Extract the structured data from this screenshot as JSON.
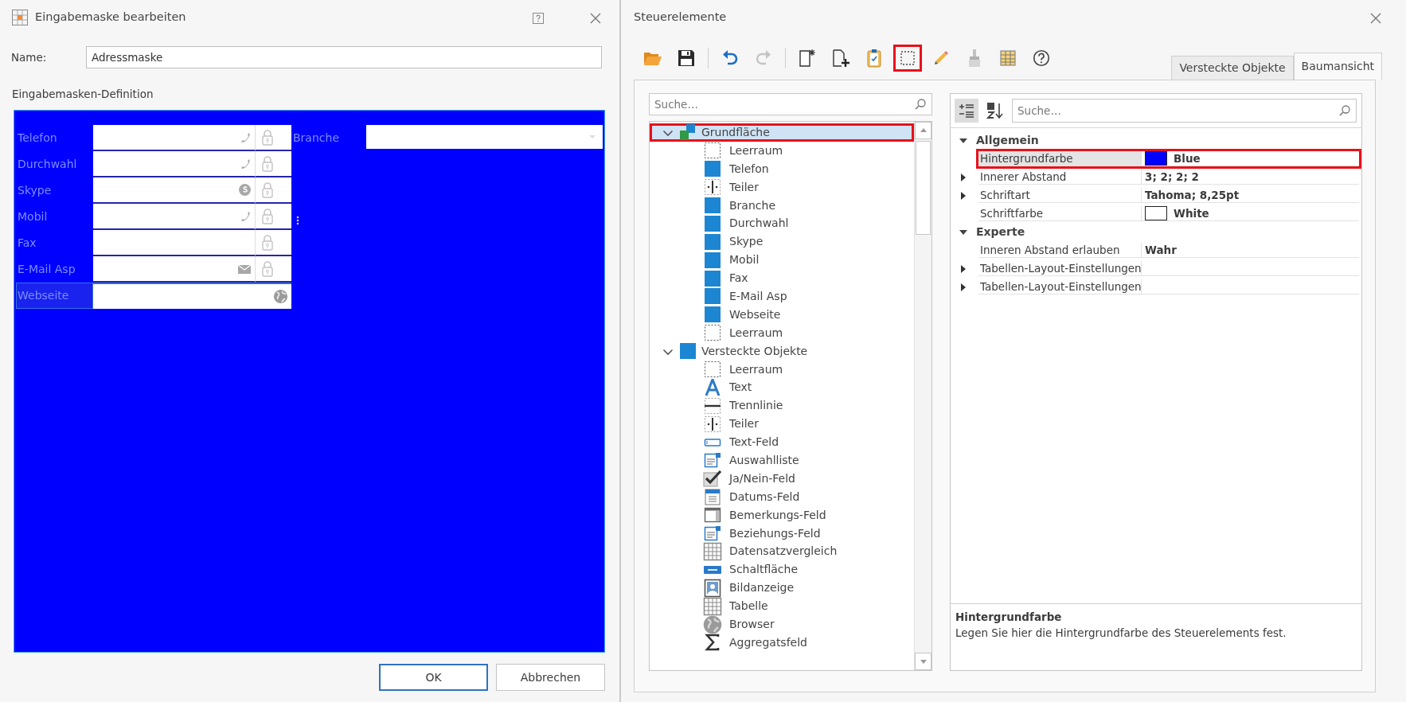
{
  "left_window": {
    "title": "Eingabemaske bearbeiten",
    "name_label": "Name:",
    "name_value": "Adressmaske",
    "section_label": "Eingabemasken-Definition",
    "canvas": {
      "color": "#0000ff",
      "fields": [
        {
          "label": "Telefon",
          "kind": "phone",
          "locked": true,
          "selected": false,
          "resize_handle": false
        },
        {
          "label": "Durchwahl",
          "kind": "phone",
          "locked": true,
          "selected": false,
          "resize_handle": false
        },
        {
          "label": "Skype",
          "kind": "skype",
          "locked": true,
          "selected": false,
          "resize_handle": false
        },
        {
          "label": "Mobil",
          "kind": "phone",
          "locked": true,
          "selected": false,
          "resize_handle": true
        },
        {
          "label": "Fax",
          "kind": "plain",
          "locked": true,
          "selected": false,
          "resize_handle": false
        },
        {
          "label": "E-Mail Asp",
          "kind": "mail",
          "locked": true,
          "selected": false,
          "resize_handle": false
        },
        {
          "label": "Webseite",
          "kind": "globe",
          "locked": false,
          "selected": true,
          "resize_handle": false
        }
      ],
      "branche": {
        "label": "Branche"
      }
    },
    "buttons": [
      {
        "label": "OK",
        "default": true
      },
      {
        "label": "Abbrechen",
        "default": false
      }
    ]
  },
  "right_window": {
    "title": "Steuerelemente",
    "toolbar_groups": [
      {
        "buttons": [
          {
            "kind": "folder",
            "disabled": false,
            "highlighted": false
          },
          {
            "kind": "save",
            "disabled": false,
            "highlighted": false
          }
        ]
      },
      {
        "buttons": [
          {
            "kind": "undo",
            "disabled": false,
            "highlighted": false
          },
          {
            "kind": "redo",
            "disabled": true,
            "highlighted": false
          }
        ]
      },
      {
        "buttons": [
          {
            "kind": "new-page",
            "disabled": false,
            "highlighted": false
          },
          {
            "kind": "add-page",
            "disabled": false,
            "highlighted": false
          },
          {
            "kind": "clipboard",
            "disabled": false,
            "highlighted": false
          },
          {
            "kind": "frame",
            "disabled": false,
            "highlighted": true
          },
          {
            "kind": "pencil",
            "disabled": false,
            "highlighted": false
          },
          {
            "kind": "brush",
            "disabled": true,
            "highlighted": false
          },
          {
            "kind": "table",
            "disabled": false,
            "highlighted": false
          },
          {
            "kind": "help",
            "disabled": false,
            "highlighted": false
          }
        ]
      }
    ],
    "tabs": [
      {
        "label": "Versteckte Objekte",
        "selected": false
      },
      {
        "label": "Baumansicht",
        "selected": true
      }
    ],
    "tree": {
      "search_placeholder": "Suche…",
      "items": [
        {
          "label": "Grundfläche",
          "kind": "stack",
          "expanded": true,
          "selected": true,
          "highlighted": true,
          "children": [
            {
              "label": "Leerraum",
              "kind": "space"
            },
            {
              "label": "Telefon",
              "kind": "block"
            },
            {
              "label": "Teiler",
              "kind": "divider"
            },
            {
              "label": "Branche",
              "kind": "block"
            },
            {
              "label": "Durchwahl",
              "kind": "block"
            },
            {
              "label": "Skype",
              "kind": "block"
            },
            {
              "label": "Mobil",
              "kind": "block"
            },
            {
              "label": "Fax",
              "kind": "block"
            },
            {
              "label": "E-Mail Asp",
              "kind": "block"
            },
            {
              "label": "Webseite",
              "kind": "block"
            },
            {
              "label": "Leerraum",
              "kind": "space"
            }
          ]
        },
        {
          "label": "Versteckte Objekte",
          "kind": "block",
          "expanded": true,
          "selected": false,
          "highlighted": false,
          "children": [
            {
              "label": "Leerraum",
              "kind": "space"
            },
            {
              "label": "Text",
              "kind": "text"
            },
            {
              "label": "Trennlinie",
              "kind": "line"
            },
            {
              "label": "Teiler",
              "kind": "divider"
            },
            {
              "label": "Text-Feld",
              "kind": "textfield"
            },
            {
              "label": "Auswahlliste",
              "kind": "list"
            },
            {
              "label": "Ja/Nein-Feld",
              "kind": "check"
            },
            {
              "label": "Datums-Feld",
              "kind": "calendar"
            },
            {
              "label": "Bemerkungs-Feld",
              "kind": "memo"
            },
            {
              "label": "Beziehungs-Feld",
              "kind": "list"
            },
            {
              "label": "Datensatzvergleich",
              "kind": "grid"
            },
            {
              "label": "Schaltfläche",
              "kind": "okbutton"
            },
            {
              "label": "Bildanzeige",
              "kind": "portrait"
            },
            {
              "label": "Tabelle",
              "kind": "grid"
            },
            {
              "label": "Browser",
              "kind": "globe"
            },
            {
              "label": "Aggregatsfeld",
              "kind": "sigma"
            }
          ]
        }
      ]
    },
    "properties": {
      "view_buttons": [
        {
          "kind": "categorized",
          "selected": true
        },
        {
          "kind": "alphabetical",
          "selected": false
        }
      ],
      "search_placeholder": "Suche…",
      "categories": [
        {
          "label": "Allgemein",
          "expanded": true,
          "rows": [
            {
              "name": "Hintergrundfarbe",
              "value": "Blue",
              "color": "#0000ff",
              "expandable": false,
              "selected": true,
              "highlighted": true
            },
            {
              "name": "Innerer Abstand",
              "value": "3; 2; 2; 2",
              "expandable": true,
              "selected": false,
              "highlighted": false
            },
            {
              "name": "Schriftart",
              "value": "Tahoma; 8,25pt",
              "expandable": true,
              "selected": false,
              "highlighted": false
            },
            {
              "name": "Schriftfarbe",
              "value": "White",
              "color": "#ffffff",
              "expandable": false,
              "selected": false,
              "highlighted": false
            }
          ]
        },
        {
          "label": "Experte",
          "expanded": true,
          "rows": [
            {
              "name": "Inneren Abstand erlauben",
              "value": "Wahr",
              "expandable": false,
              "selected": false,
              "highlighted": false
            },
            {
              "name": "Tabellen-Layout-Einstellungen",
              "expandable": true,
              "selected": false,
              "highlighted": false
            },
            {
              "name": "Tabellen-Layout-Einstellungen",
              "expandable": true,
              "selected": false,
              "highlighted": false
            }
          ]
        }
      ],
      "description": {
        "title": "Hintergrundfarbe",
        "text": "Legen Sie hier die Hintergrundfarbe des Steuerelements fest."
      }
    }
  }
}
